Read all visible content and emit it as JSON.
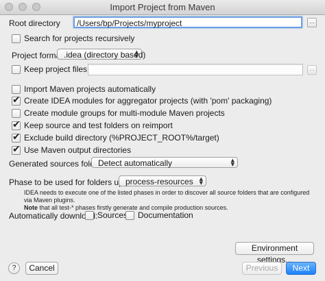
{
  "window": {
    "title": "Import Project from Maven"
  },
  "root_directory": {
    "label": "Root directory",
    "value": "/Users/bp/Projects/myproject",
    "browse_label": "..."
  },
  "options": {
    "search_recursively": {
      "label": "Search for projects recursively",
      "checked": false
    },
    "project_format": {
      "label": "Project format:",
      "value": ".idea (directory based)"
    },
    "keep_project_files": {
      "label": "Keep project files in:",
      "checked": false,
      "value": "",
      "browse_label": "..."
    },
    "import_auto": {
      "label": "Import Maven projects automatically",
      "checked": false
    },
    "create_modules_aggregator": {
      "label": "Create IDEA modules for aggregator projects (with 'pom' packaging)",
      "checked": true
    },
    "create_module_groups": {
      "label": "Create module groups for multi-module Maven projects",
      "checked": false
    },
    "keep_source_folders": {
      "label": "Keep source and test folders on reimport",
      "checked": true
    },
    "exclude_build_dir": {
      "label": "Exclude build directory (%PROJECT_ROOT%/target)",
      "checked": true
    },
    "use_maven_output": {
      "label": "Use Maven output directories",
      "checked": true
    }
  },
  "generated_sources": {
    "label": "Generated sources folders:",
    "value": "Detect automatically"
  },
  "phase": {
    "label": "Phase to be used for folders update:",
    "value": "process-resources",
    "note_line1": "IDEA needs to execute one of the listed phases in order to discover all source folders that are configured via Maven plugins.",
    "note_bold": "Note",
    "note_line2": " that all test-* phases firstly generate and compile production sources."
  },
  "auto_download": {
    "label": "Automatically download:",
    "sources": {
      "label": "Sources",
      "checked": false
    },
    "documentation": {
      "label": "Documentation",
      "checked": false
    }
  },
  "buttons": {
    "environment": "Environment settings...",
    "help": "?",
    "cancel": "Cancel",
    "previous": "Previous",
    "next": "Next"
  },
  "colors": {
    "accent": "#1a82fb",
    "focus_ring": "#6d9fe1",
    "background": "#ececec"
  }
}
